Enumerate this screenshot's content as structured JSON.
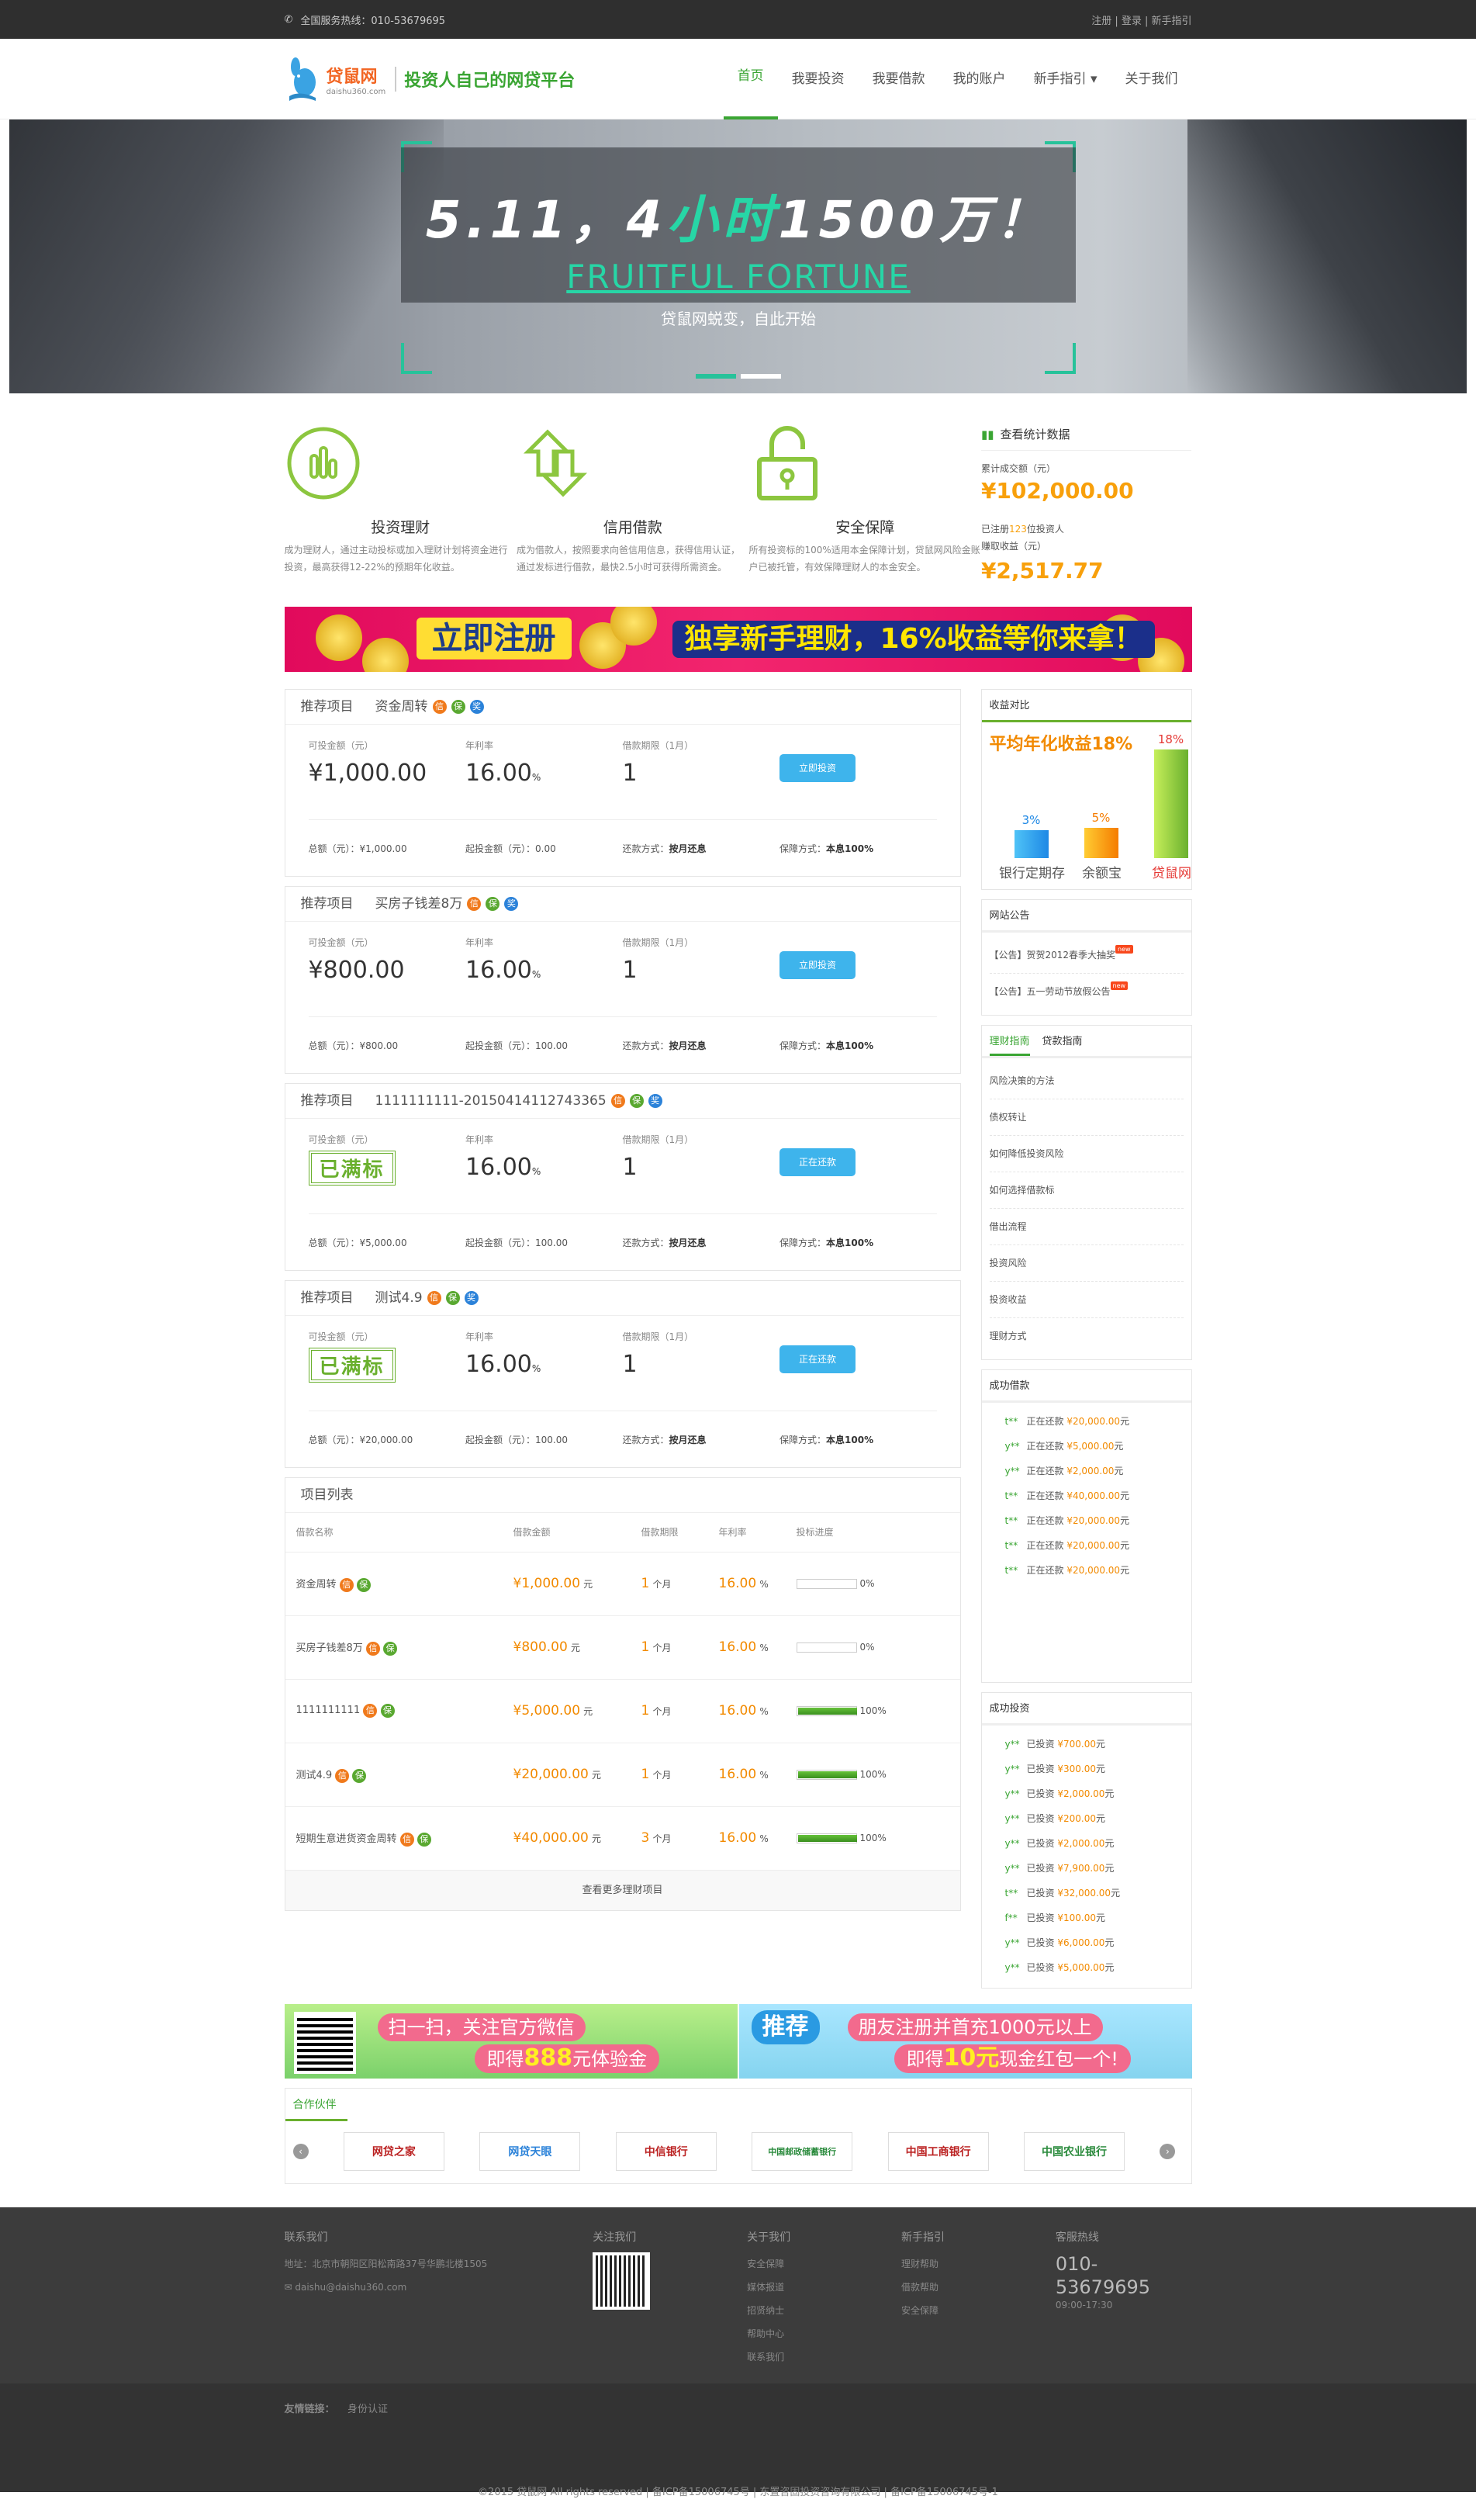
{
  "topbar": {
    "phone": "全国服务热线：010-53679695",
    "links": "注册 | 登录 | 新手指引"
  },
  "logo": {
    "brand": "贷鼠网",
    "domain": "daishu360.com",
    "slogan": "投资人自己的网贷平台"
  },
  "nav": [
    "首页",
    "我要投资",
    "我要借款",
    "我的账户",
    "新手指引 ▾",
    "关于我们"
  ],
  "banner": {
    "line1a": "5.11，4",
    "line1b": "小时",
    "line1c": "1500万！",
    "line2": "FRUITFUL FORTUNE",
    "line3": "贷鼠网蜕变，自此开始"
  },
  "features": [
    {
      "title": "投资理财",
      "desc": "成为理财人，通过主动投标或加入理财计划将资金进行投资，最高获得12-22%的预期年化收益。"
    },
    {
      "title": "信用借款",
      "desc": "成为借款人，按照要求向爸信用信息，获得信用认证，通过发标进行借款，最快2.5小时可获得所需资金。"
    },
    {
      "title": "安全保障",
      "desc": "所有投资标的100%适用本金保障计划，贷鼠网风险金账户已被托管，有效保障理财人的本金安全。"
    }
  ],
  "stats": {
    "title": "查看统计数据",
    "label1": "累计成交额（元）",
    "value1": "¥102,000.00",
    "investors_pre": "已注册",
    "investors_num": "123",
    "investors_post": "位投资人",
    "label2": "赚取收益（元）",
    "value2": "¥2,517.77"
  },
  "ad": {
    "t1": "立即注册",
    "t2": "独享新手理财，16%收益等你来拿！"
  },
  "projects": [
    {
      "header": "推荐项目",
      "name": "资金周转",
      "l1": "可投金额（元）",
      "v1": "¥1,000.00",
      "l2": "年利率",
      "v2": "16.00",
      "unit": "%",
      "l3": "借款期限（1月）",
      "v3": "1",
      "btn": "立即投资",
      "full": false,
      "total": "总额（元）：¥1,000.00",
      "min": "起投金额（元）：0.00",
      "repay_l": "还款方式：",
      "repay": "按月还息",
      "guar_l": "保障方式：",
      "guar": "本息100%"
    },
    {
      "header": "推荐项目",
      "name": "买房子钱差8万",
      "l1": "可投金额（元）",
      "v1": "¥800.00",
      "l2": "年利率",
      "v2": "16.00",
      "unit": "%",
      "l3": "借款期限（1月）",
      "v3": "1",
      "btn": "立即投资",
      "full": false,
      "total": "总额（元）：¥800.00",
      "min": "起投金额（元）：100.00",
      "repay_l": "还款方式：",
      "repay": "按月还息",
      "guar_l": "保障方式：",
      "guar": "本息100%"
    },
    {
      "header": "推荐项目",
      "name": "1111111111-20150414112743365",
      "l1": "可投金额（元）",
      "v1": "已满标",
      "l2": "年利率",
      "v2": "16.00",
      "unit": "%",
      "l3": "借款期限（1月）",
      "v3": "1",
      "btn": "正在还款",
      "full": true,
      "total": "总额（元）：¥5,000.00",
      "min": "起投金额（元）：100.00",
      "repay_l": "还款方式：",
      "repay": "按月还息",
      "guar_l": "保障方式：",
      "guar": "本息100%"
    },
    {
      "header": "推荐项目",
      "name": "测试4.9",
      "l1": "可投金额（元）",
      "v1": "已满标",
      "l2": "年利率",
      "v2": "16.00",
      "unit": "%",
      "l3": "借款期限（1月）",
      "v3": "1",
      "btn": "正在还款",
      "full": true,
      "total": "总额（元）：¥20,000.00",
      "min": "起投金额（元）：100.00",
      "repay_l": "还款方式：",
      "repay": "按月还息",
      "guar_l": "保障方式：",
      "guar": "本息100%"
    }
  ],
  "list": {
    "title": "项目列表",
    "headers": [
      "借款名称",
      "借款金额",
      "借款期限",
      "年利率",
      "投标进度"
    ],
    "rows": [
      {
        "name": "资金周转",
        "amount": "¥1,000.00",
        "yuan": "元",
        "term": "1",
        "tunit": "个月",
        "rate": "16.00",
        "runit": "%",
        "progress": 0,
        "ptext": "0%"
      },
      {
        "name": "买房子钱差8万",
        "amount": "¥800.00",
        "yuan": "元",
        "term": "1",
        "tunit": "个月",
        "rate": "16.00",
        "runit": "%",
        "progress": 0,
        "ptext": "0%"
      },
      {
        "name": "1111111111",
        "amount": "¥5,000.00",
        "yuan": "元",
        "term": "1",
        "tunit": "个月",
        "rate": "16.00",
        "runit": "%",
        "progress": 100,
        "ptext": "100%"
      },
      {
        "name": "测试4.9",
        "amount": "¥20,000.00",
        "yuan": "元",
        "term": "1",
        "tunit": "个月",
        "rate": "16.00",
        "runit": "%",
        "progress": 100,
        "ptext": "100%"
      },
      {
        "name": "短期生意进货资金周转",
        "amount": "¥40,000.00",
        "yuan": "元",
        "term": "3",
        "tunit": "个月",
        "rate": "16.00",
        "runit": "%",
        "progress": 100,
        "ptext": "100%"
      }
    ],
    "more": "查看更多理财项目"
  },
  "yield": {
    "title": "收益对比",
    "headline": "平均年化收益18%",
    "bars": [
      {
        "name": "银行定期存",
        "pct": "3%",
        "value": 3
      },
      {
        "name": "余额宝",
        "pct": "5%",
        "value": 5
      },
      {
        "name": "贷鼠网",
        "pct": "18%",
        "value": 18
      }
    ]
  },
  "notice": {
    "title": "网站公告",
    "items": [
      "【公告】贺贺2012春季大抽奖",
      "【公告】五一劳动节放假公告"
    ]
  },
  "guide": {
    "tab1": "理财指南",
    "tab2": "贷款指南",
    "items": [
      "风险决策的方法",
      "债权转让",
      "如何降低投资风险",
      "如何选择借款标",
      "借出流程",
      "投资风险",
      "投资收益",
      "理财方式"
    ]
  },
  "loans": {
    "title": "成功借款",
    "items": [
      {
        "u": "t**",
        "a": "正在还款",
        "m": "¥20,000.00",
        "y": "元"
      },
      {
        "u": "y**",
        "a": "正在还款",
        "m": "¥5,000.00",
        "y": "元"
      },
      {
        "u": "y**",
        "a": "正在还款",
        "m": "¥2,000.00",
        "y": "元"
      },
      {
        "u": "t**",
        "a": "正在还款",
        "m": "¥40,000.00",
        "y": "元"
      },
      {
        "u": "t**",
        "a": "正在还款",
        "m": "¥20,000.00",
        "y": "元"
      },
      {
        "u": "t**",
        "a": "正在还款",
        "m": "¥20,000.00",
        "y": "元"
      },
      {
        "u": "t**",
        "a": "正在还款",
        "m": "¥20,000.00",
        "y": "元"
      }
    ]
  },
  "invests": {
    "title": "成功投资",
    "items": [
      {
        "u": "y**",
        "a": "已投资",
        "m": "¥700.00",
        "y": "元"
      },
      {
        "u": "y**",
        "a": "已投资",
        "m": "¥300.00",
        "y": "元"
      },
      {
        "u": "y**",
        "a": "已投资",
        "m": "¥2,000.00",
        "y": "元"
      },
      {
        "u": "y**",
        "a": "已投资",
        "m": "¥200.00",
        "y": "元"
      },
      {
        "u": "y**",
        "a": "已投资",
        "m": "¥2,000.00",
        "y": "元"
      },
      {
        "u": "y**",
        "a": "已投资",
        "m": "¥7,900.00",
        "y": "元"
      },
      {
        "u": "t**",
        "a": "已投资",
        "m": "¥32,000.00",
        "y": "元"
      },
      {
        "u": "f**",
        "a": "已投资",
        "m": "¥100.00",
        "y": "元"
      },
      {
        "u": "y**",
        "a": "已投资",
        "m": "¥6,000.00",
        "y": "元"
      },
      {
        "u": "y**",
        "a": "已投资",
        "m": "¥5,000.00",
        "y": "元"
      }
    ]
  },
  "bads": {
    "a1": "扫一扫，关注官方微信",
    "a2pre": "即得",
    "a2num": "888",
    "a2post": "元体验金",
    "b0": "推荐",
    "b1": "朋友注册并首充1000元以上",
    "b2pre": "即得",
    "b2num": "10元",
    "b2post": "现金红包一个!"
  },
  "partners": {
    "title": "合作伙伴",
    "logos": [
      "网贷之家",
      "网贷天眼",
      "中信银行",
      "中国邮政储蓄银行",
      "中国工商银行",
      "中国农业银行"
    ]
  },
  "footer": {
    "contact": {
      "title": "联系我们",
      "addr": "地址：北京市朝阳区阳松南路37号华鹏北楼1505",
      "email": "daishu@daishu360.com"
    },
    "follow": "关注我们",
    "about": {
      "title": "关于我们",
      "items": [
        "安全保障",
        "媒体报道",
        "招贤纳士",
        "帮助中心",
        "联系我们"
      ]
    },
    "guide": {
      "title": "新手指引",
      "items": [
        "理财帮助",
        "借款帮助",
        "安全保障"
      ]
    },
    "service": {
      "title": "客服热线",
      "phone": "010-53679695",
      "hours": "09:00-17:30"
    },
    "friends": "友情链接：",
    "friend1": "身份认证",
    "copy": "©2015 贷鼠网 All rights reserved | 备ICP备15006745号 | 东置咨固投资咨询有限公司 | 备ICP备15006745号-1"
  }
}
